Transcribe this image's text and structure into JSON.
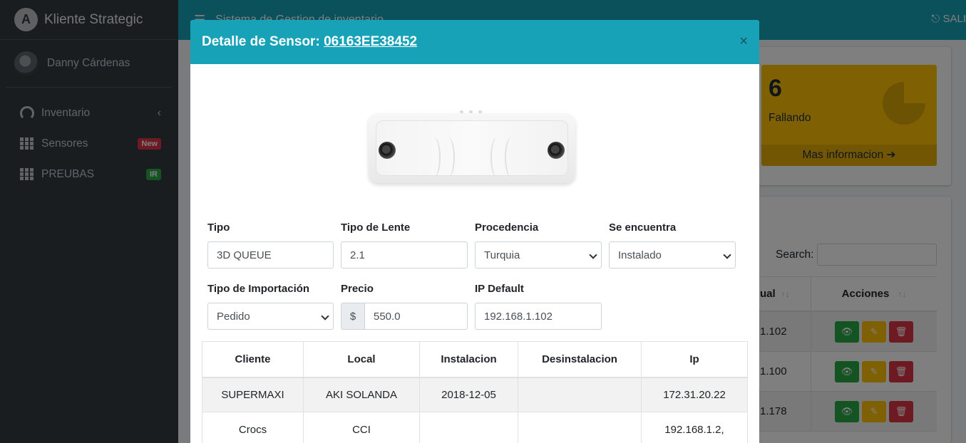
{
  "app": {
    "brand": "Kliente Strategic",
    "title": "Sistema de Gestion de inventario",
    "logout": "SALI"
  },
  "user": {
    "name": "Danny Cárdenas"
  },
  "sidebar": {
    "items": [
      {
        "label": "Inventario",
        "icon": "gauge-icon",
        "badge": ""
      },
      {
        "label": "Sensores",
        "icon": "grid-icon",
        "badge": "New"
      },
      {
        "label": "PREUBAS",
        "icon": "grid-icon",
        "badge": "IR"
      }
    ]
  },
  "infobox": {
    "value": "6",
    "label": "Fallando",
    "link": "Mas informacion"
  },
  "background_table": {
    "search_label": "Search:",
    "headers": [
      "ual",
      "Acciones"
    ],
    "rows": [
      "1.102",
      "1.100",
      "1.178"
    ]
  },
  "modal": {
    "title_prefix": "Detalle de Sensor:",
    "sensor_code": "06163EE38452",
    "close": "×",
    "fields": {
      "tipo": {
        "label": "Tipo",
        "value": "3D QUEUE"
      },
      "tipo_lente": {
        "label": "Tipo de Lente",
        "value": "2.1"
      },
      "procedencia": {
        "label": "Procedencia",
        "value": "Turquia"
      },
      "se_encuentra": {
        "label": "Se encuentra",
        "value": "Instalado"
      },
      "tipo_importacion": {
        "label": "Tipo de Importación",
        "value": "Pedido"
      },
      "precio": {
        "label": "Precio",
        "currency": "$",
        "value": "550.0"
      },
      "ip_default": {
        "label": "IP Default",
        "value": "192.168.1.102"
      }
    },
    "table": {
      "headers": [
        "Cliente",
        "Local",
        "Instalacion",
        "Desinstalacion",
        "Ip"
      ],
      "rows": [
        [
          "SUPERMAXI",
          "AKI SOLANDA",
          "2018-12-05",
          "",
          "172.31.20.22"
        ],
        [
          "Crocs",
          "CCI",
          "",
          "",
          "192.168.1.2,"
        ]
      ]
    }
  },
  "colors": {
    "header": "#17a2b8",
    "sidebar": "#343a40",
    "warning": "#ffc107",
    "success": "#28a745",
    "danger": "#dc3545"
  }
}
